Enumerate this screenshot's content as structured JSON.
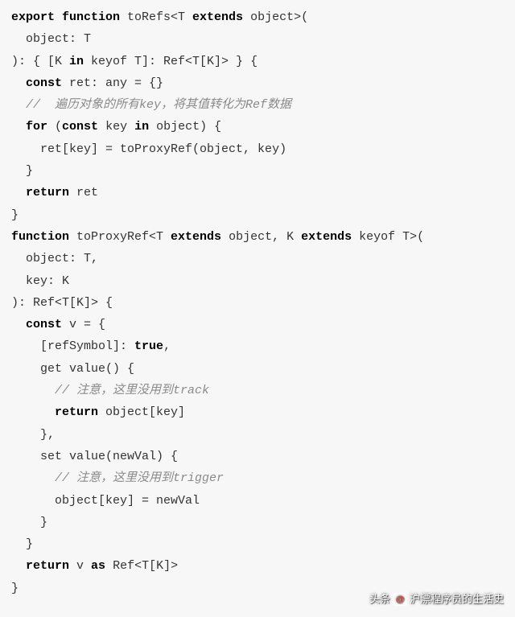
{
  "code": {
    "lines": [
      {
        "indent": 0,
        "segments": [
          {
            "type": "keyword",
            "text": "export function"
          },
          {
            "type": "plain",
            "text": " toRefs<T "
          },
          {
            "type": "keyword",
            "text": "extends"
          },
          {
            "type": "plain",
            "text": " object>("
          }
        ]
      },
      {
        "indent": 1,
        "segments": [
          {
            "type": "plain",
            "text": "object: T"
          }
        ]
      },
      {
        "indent": 0,
        "segments": [
          {
            "type": "plain",
            "text": "): { [K "
          },
          {
            "type": "keyword",
            "text": "in"
          },
          {
            "type": "plain",
            "text": " keyof T]: Ref<T[K]> } {"
          }
        ]
      },
      {
        "indent": 1,
        "segments": [
          {
            "type": "keyword",
            "text": "const"
          },
          {
            "type": "plain",
            "text": " ret: any = {}"
          }
        ]
      },
      {
        "indent": 1,
        "segments": [
          {
            "type": "comment",
            "text": "//  遍历对象的所有key，将其值转化为Ref数据"
          }
        ]
      },
      {
        "indent": 1,
        "segments": [
          {
            "type": "keyword",
            "text": "for"
          },
          {
            "type": "plain",
            "text": " ("
          },
          {
            "type": "keyword",
            "text": "const"
          },
          {
            "type": "plain",
            "text": " key "
          },
          {
            "type": "keyword",
            "text": "in"
          },
          {
            "type": "plain",
            "text": " object) {"
          }
        ]
      },
      {
        "indent": 2,
        "segments": [
          {
            "type": "plain",
            "text": "ret[key] = toProxyRef(object, key)"
          }
        ]
      },
      {
        "indent": 1,
        "segments": [
          {
            "type": "plain",
            "text": "}"
          }
        ]
      },
      {
        "indent": 1,
        "segments": [
          {
            "type": "keyword",
            "text": "return"
          },
          {
            "type": "plain",
            "text": " ret"
          }
        ]
      },
      {
        "indent": 0,
        "segments": [
          {
            "type": "plain",
            "text": "}"
          }
        ]
      },
      {
        "indent": 0,
        "segments": [
          {
            "type": "keyword",
            "text": "function"
          },
          {
            "type": "plain",
            "text": " toProxyRef<T "
          },
          {
            "type": "keyword",
            "text": "extends"
          },
          {
            "type": "plain",
            "text": " object, K "
          },
          {
            "type": "keyword",
            "text": "extends"
          },
          {
            "type": "plain",
            "text": " keyof T>("
          }
        ]
      },
      {
        "indent": 1,
        "segments": [
          {
            "type": "plain",
            "text": "object: T,"
          }
        ]
      },
      {
        "indent": 1,
        "segments": [
          {
            "type": "plain",
            "text": "key: K"
          }
        ]
      },
      {
        "indent": 0,
        "segments": [
          {
            "type": "plain",
            "text": "): Ref<T[K]> {"
          }
        ]
      },
      {
        "indent": 1,
        "segments": [
          {
            "type": "keyword",
            "text": "const"
          },
          {
            "type": "plain",
            "text": " v = {"
          }
        ]
      },
      {
        "indent": 2,
        "segments": [
          {
            "type": "plain",
            "text": "[refSymbol]: "
          },
          {
            "type": "keyword",
            "text": "true"
          },
          {
            "type": "plain",
            "text": ","
          }
        ]
      },
      {
        "indent": 2,
        "segments": [
          {
            "type": "plain",
            "text": "get value() {"
          }
        ]
      },
      {
        "indent": 3,
        "segments": [
          {
            "type": "comment",
            "text": "// 注意，这里没用到track"
          }
        ]
      },
      {
        "indent": 3,
        "segments": [
          {
            "type": "keyword",
            "text": "return"
          },
          {
            "type": "plain",
            "text": " object[key]"
          }
        ]
      },
      {
        "indent": 2,
        "segments": [
          {
            "type": "plain",
            "text": "},"
          }
        ]
      },
      {
        "indent": 2,
        "segments": [
          {
            "type": "plain",
            "text": "set value(newVal) {"
          }
        ]
      },
      {
        "indent": 3,
        "segments": [
          {
            "type": "comment",
            "text": "// 注意，这里没用到trigger"
          }
        ]
      },
      {
        "indent": 3,
        "segments": [
          {
            "type": "plain",
            "text": "object[key] = newVal"
          }
        ]
      },
      {
        "indent": 2,
        "segments": [
          {
            "type": "plain",
            "text": "}"
          }
        ]
      },
      {
        "indent": 1,
        "segments": [
          {
            "type": "plain",
            "text": "}"
          }
        ]
      },
      {
        "indent": 1,
        "segments": [
          {
            "type": "keyword",
            "text": "return"
          },
          {
            "type": "plain",
            "text": " v "
          },
          {
            "type": "keyword",
            "text": "as"
          },
          {
            "type": "plain",
            "text": " Ref<T[K]>"
          }
        ]
      },
      {
        "indent": 0,
        "segments": [
          {
            "type": "plain",
            "text": "}"
          }
        ]
      }
    ]
  },
  "watermark": {
    "prefix": "头条",
    "icon": "@",
    "text": "沪漂程序员的生活史"
  }
}
